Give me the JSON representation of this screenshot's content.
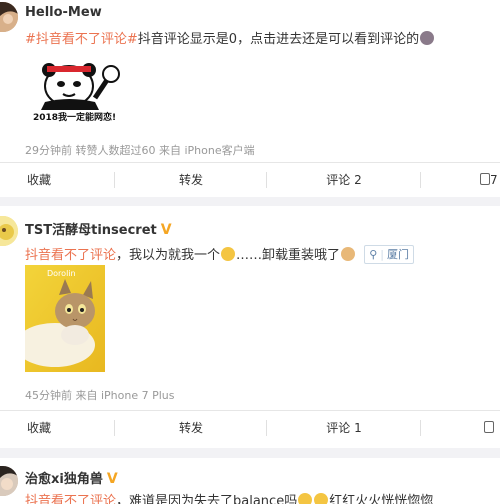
{
  "posts": [
    {
      "author": "Hello-Mew",
      "text_parts": {
        "tag": "#抖音看不了评论#",
        "rest": "抖音评论显示是0，点击进去还是可以看到评论的"
      },
      "meme_caption": "2018我一定能网恋!",
      "meta": "29分钟前 转赞人数超过60 来自 iPhone客户端",
      "actions": {
        "favorite": "收藏",
        "repost": "转发",
        "comment": "评论 2",
        "like": "7"
      }
    },
    {
      "author": "TST活酵母tinsecret",
      "verified": "V",
      "text_parts": {
        "topic": "抖音看不了评论",
        "rest1": "，我以为就我一个",
        "rest2": "……卸载重装哦了",
        "location": "厦门"
      },
      "photo_watermark": "Dorolin",
      "meta": "45分钟前 来自 iPhone 7 Plus",
      "actions": {
        "favorite": "收藏",
        "repost": "转发",
        "comment": "评论 1",
        "like": ""
      }
    },
    {
      "author": "治愈xi独角兽",
      "verified": "V",
      "text_parts": {
        "topic": "抖音看不了评论",
        "rest1": "，难道是因为失去了balance吗",
        "rest2": "红红火火恍恍惚惚"
      }
    }
  ],
  "colors": {
    "link_orange": "#eb7350",
    "badge_gold": "#f5a623",
    "meta_gray": "#999999"
  },
  "icons": {
    "location": "location-pin-icon",
    "like": "thumbs-up-icon"
  }
}
